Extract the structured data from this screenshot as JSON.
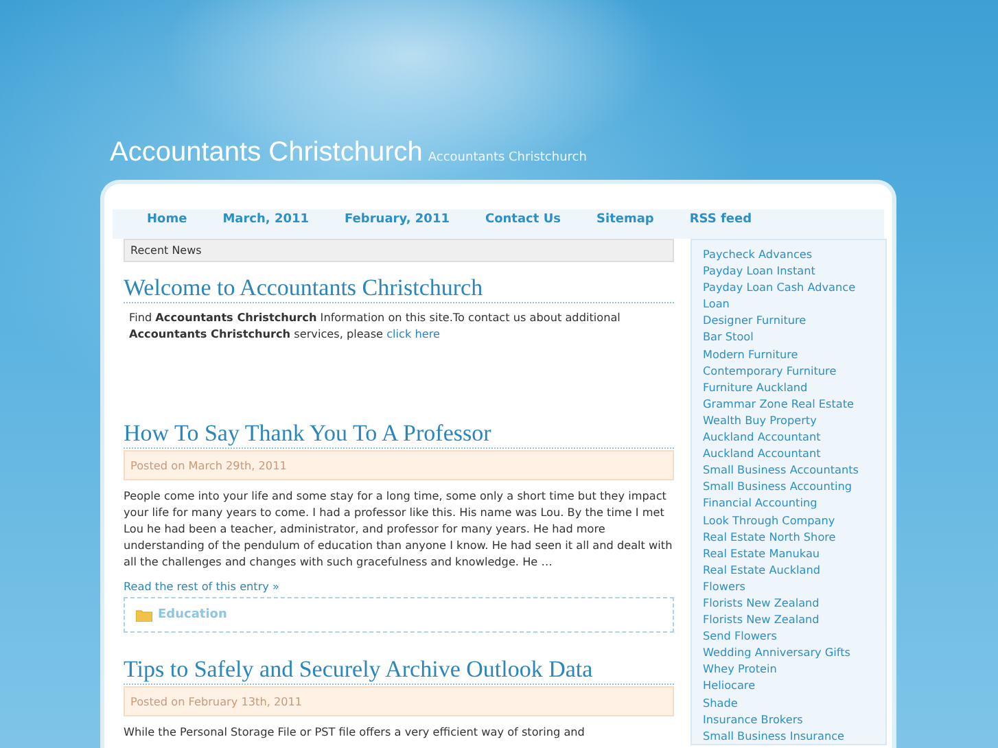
{
  "header": {
    "title": "Accountants Christchurch",
    "tagline": "Accountants Christchurch"
  },
  "nav": [
    {
      "label": "Home"
    },
    {
      "label": "March, 2011"
    },
    {
      "label": "February, 2011"
    },
    {
      "label": "Contact Us"
    },
    {
      "label": "Sitemap"
    },
    {
      "label": "RSS feed"
    }
  ],
  "recent_news": "Recent News",
  "posts": [
    {
      "kind": "intro",
      "title": "Welcome to Accountants Christchurch",
      "text": "Find **Accountants Christchurch** Information on this site.To contact us about additional **Accountants Christchurch** services, please ",
      "link": "click here"
    },
    {
      "kind": "entry",
      "title": "How To Say Thank You To A Professor",
      "date": "Posted on March 29th, 2011",
      "text": "People come into your life and some stay for a long time, some only a short time but they impact your life for many years to come.  I had a professor like this.  His name was Lou.  By the time I met Lou he had been a teacher, administrator, and professor for many years.  He had more understanding of the pendulum of education than anyone I know.  He had seen it all and dealt with all the challenges and changes with such gracefulness and knowledge.  He …",
      "read_more": "Read the rest of this entry »",
      "category": "Education"
    },
    {
      "kind": "entry",
      "title": "Tips to Safely and Securely Archive Outlook Data",
      "date": "Posted on February 13th, 2011",
      "text": "While the Personal Storage File or PST file offers a very efficient way of storing and"
    }
  ],
  "sidebar_links": [
    "Paycheck Advances",
    "Payday Loan Instant",
    "Payday Loan Cash Advance",
    "Loan",
    "Designer Furniture",
    "Bar Stool",
    "Modern Furniture",
    "Contemporary Furniture",
    "Furniture Auckland",
    "Grammar Zone Real Estate",
    "Wealth Buy Property",
    "Auckland Accountant",
    "Auckland Accountant",
    "Small Business Accountants",
    "Small Business Accounting",
    "Financial Accounting",
    "Look Through Company",
    "Real Estate North Shore",
    "Real Estate Manukau",
    "Real Estate Auckland",
    "Flowers",
    "Florists New Zealand",
    "Florists New Zealand",
    "Send Flowers",
    "Wedding Anniversary Gifts",
    "Whey Protein",
    "Heliocare",
    "Shade",
    "Insurance Brokers",
    "Small Business Insurance"
  ]
}
